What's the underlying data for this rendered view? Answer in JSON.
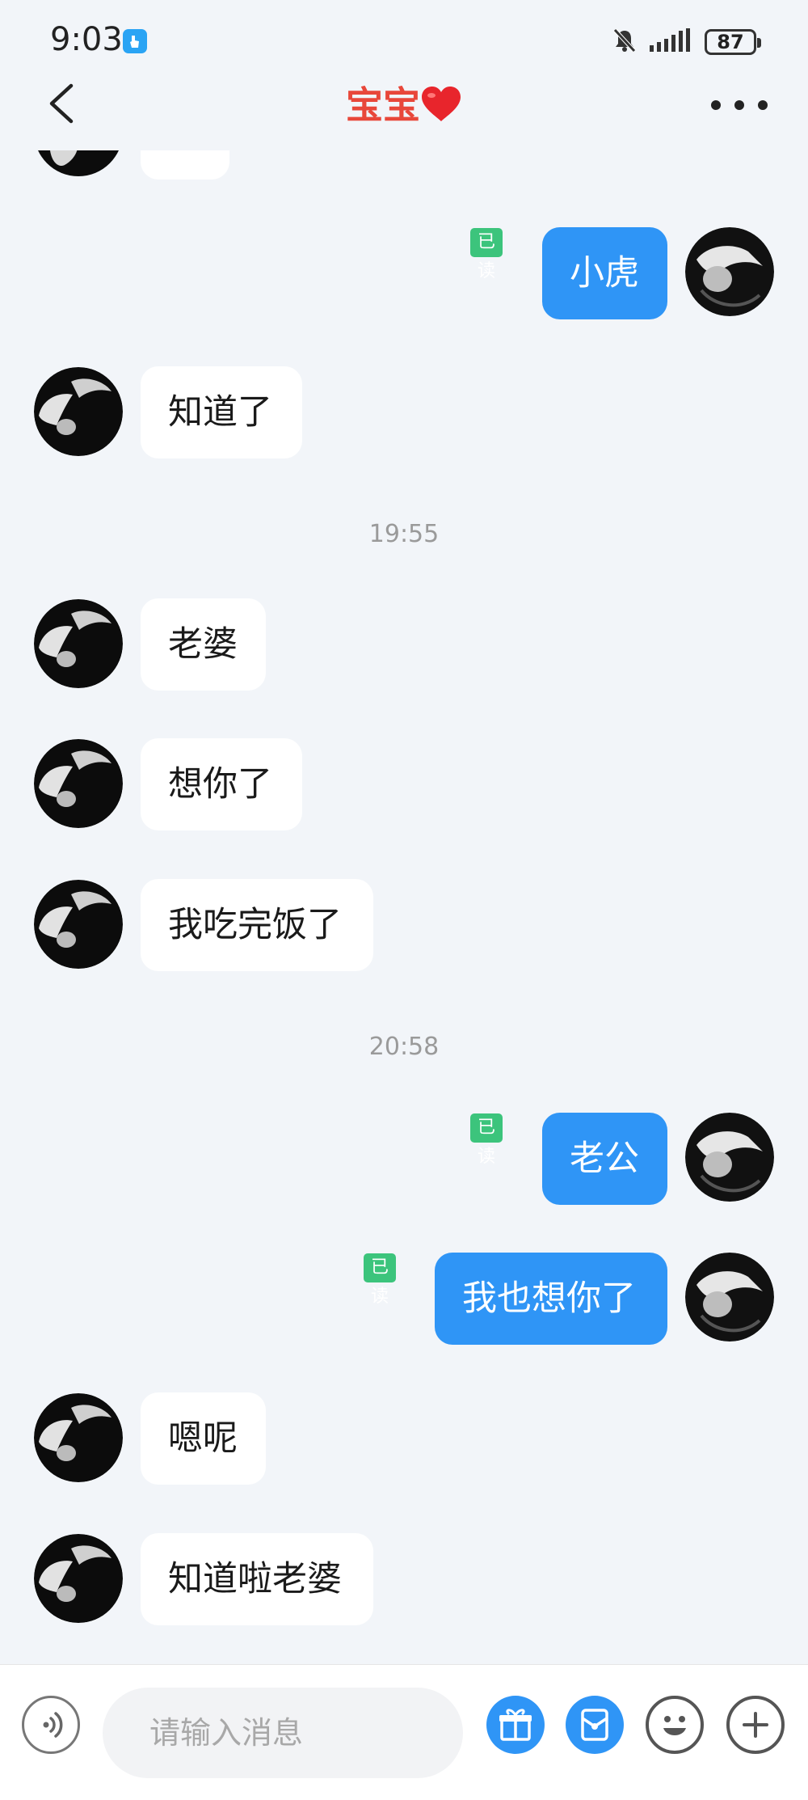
{
  "status_bar": {
    "time": "9:03",
    "battery": "87"
  },
  "header": {
    "title": "宝宝",
    "title_emoji": "❤️"
  },
  "read_label": "已读",
  "timestamps": [
    "19:55",
    "20:58"
  ],
  "messages": [
    {
      "side": "left",
      "text": ""
    },
    {
      "side": "right",
      "text": "小虎",
      "read": true
    },
    {
      "side": "left",
      "text": "知道了"
    },
    {
      "side": "left",
      "text": "老婆"
    },
    {
      "side": "left",
      "text": "想你了"
    },
    {
      "side": "left",
      "text": "我吃完饭了"
    },
    {
      "side": "right",
      "text": "老公",
      "read": true
    },
    {
      "side": "right",
      "text": "我也想你了",
      "read": true
    },
    {
      "side": "left",
      "text": "嗯呢"
    },
    {
      "side": "left",
      "text": "知道啦老婆"
    }
  ],
  "input": {
    "placeholder": "请输入消息",
    "value": ""
  },
  "icons": {
    "back": "chevron-left-icon",
    "more": "more-dots-icon",
    "voice": "voice-icon",
    "gift": "gift-icon",
    "red_packet": "red-packet-icon",
    "emoji": "emoji-icon",
    "plus": "plus-icon",
    "mute": "bell-off-icon",
    "signal": "signal-icon"
  },
  "colors": {
    "accent": "#2f95f6",
    "title": "#e8473a",
    "read_badge": "#3cc47c",
    "background": "#f2f5f9"
  }
}
